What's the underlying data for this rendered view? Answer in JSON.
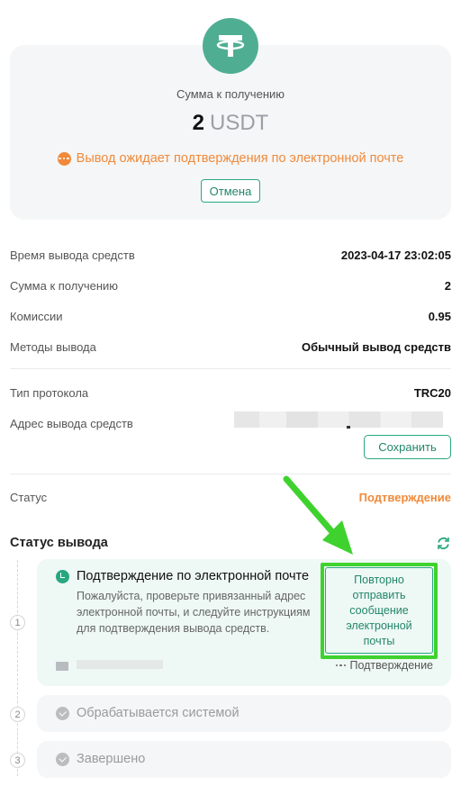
{
  "summary": {
    "label": "Сумма к получению",
    "amount": "2",
    "currency": "USDT",
    "warning": "Вывод ожидает подтверждения по электронной почте",
    "cancel_label": "Отмена"
  },
  "details": {
    "time_label": "Время вывода средств",
    "time_value": "2023-04-17 23:02:05",
    "receive_label": "Сумма к получению",
    "receive_value": "2",
    "fee_label": "Комиссии",
    "fee_value": "0.95",
    "method_label": "Методы вывода",
    "method_value": "Обычный вывод средств",
    "protocol_label": "Тип протокола",
    "protocol_value": "TRC20",
    "address_label": "Адрес вывода средств",
    "save_label": "Сохранить",
    "status_label": "Статус",
    "status_value": "Подтверждение"
  },
  "withdraw_status": {
    "title": "Статус вывода",
    "steps": [
      {
        "num": "1",
        "title": "Подтверждение по электронной почте",
        "description": "Пожалуйста, проверьте привязанный адрес электронной почты, и следуйте инструкциям для подтверждения вывода средств.",
        "resend_label": "Повторно отправить сообщение электронной почты",
        "confirm_label": "Подтверждение"
      },
      {
        "num": "2",
        "title": "Обрабатывается системой"
      },
      {
        "num": "3",
        "title": "Завершено"
      }
    ]
  },
  "colors": {
    "brand": "#27a77f",
    "warning": "#f08a3a",
    "highlight": "#3fd22e"
  },
  "icons": [
    "tether-icon",
    "warning-dots-icon",
    "refresh-icon",
    "clock-check-icon",
    "email-icon",
    "more-dots-icon",
    "check-icon",
    "arrow-annotation"
  ]
}
